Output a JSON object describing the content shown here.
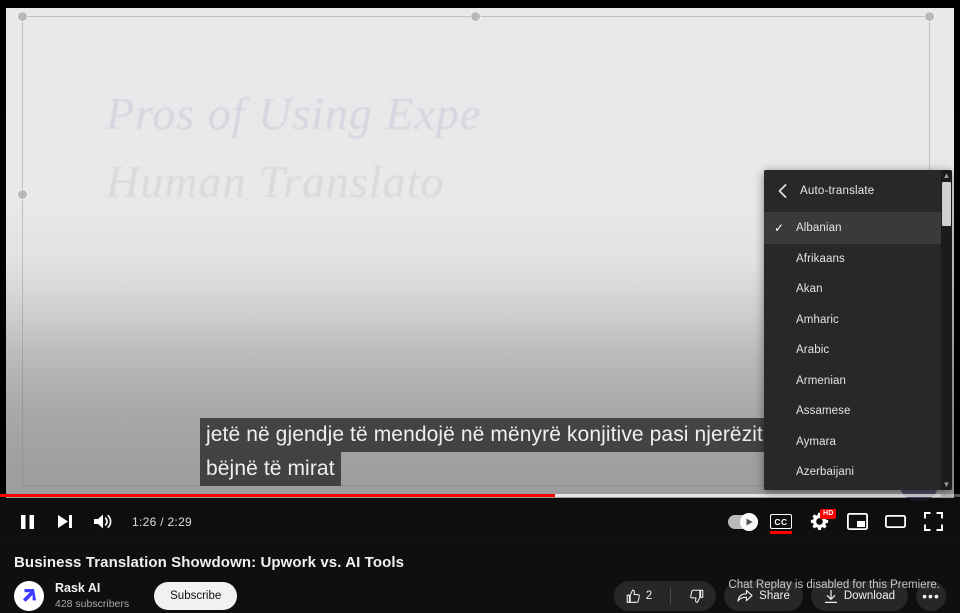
{
  "player": {
    "video_slide": {
      "line1": "Pros of Using Expe",
      "line2": "Human Translato"
    },
    "captions": {
      "line1": "jetë në gjendje të mendojë në mënyrë konjitive pasi njerëzit",
      "line2": "bëjnë të mirat"
    },
    "progress": {
      "played_percent": 57.8,
      "loaded_percent": 98
    },
    "controls": {
      "pause_label": "Pause",
      "next_label": "Next",
      "volume_label": "Volume",
      "time_display": "1:26 / 2:29",
      "current_time": "1:26",
      "duration": "2:29",
      "autoplay_label": "Autoplay",
      "captions_label": "CC",
      "settings_label": "Settings",
      "quality_badge": "HD",
      "miniplayer_label": "Miniplayer",
      "theater_label": "Theater mode",
      "fullscreen_label": "Full screen"
    },
    "settings_menu": {
      "back_icon": "chevron-left-icon",
      "title": "Auto-translate",
      "items": [
        {
          "label": "Albanian",
          "selected": true
        },
        {
          "label": "Afrikaans",
          "selected": false
        },
        {
          "label": "Akan",
          "selected": false
        },
        {
          "label": "Amharic",
          "selected": false
        },
        {
          "label": "Arabic",
          "selected": false
        },
        {
          "label": "Armenian",
          "selected": false
        },
        {
          "label": "Assamese",
          "selected": false
        },
        {
          "label": "Aymara",
          "selected": false
        },
        {
          "label": "Azerbaijani",
          "selected": false
        }
      ],
      "scroll_up": "▲",
      "scroll_down": "▼"
    }
  },
  "meta": {
    "title": "Business Translation Showdown: Upwork vs. AI Tools",
    "channel": {
      "name": "Rask AI",
      "subscribers": "428 subscribers"
    },
    "subscribe_label": "Subscribe",
    "like_count": "2",
    "share_label": "Share",
    "download_label": "Download",
    "more_label": "•••",
    "chat_note": "Chat Replay is disabled for this Premiere."
  },
  "colors": {
    "brand_red": "#ff0000",
    "rask_blue": "#3b3bff",
    "page_bg": "#0f0f0f",
    "menu_bg": "#28282a"
  }
}
